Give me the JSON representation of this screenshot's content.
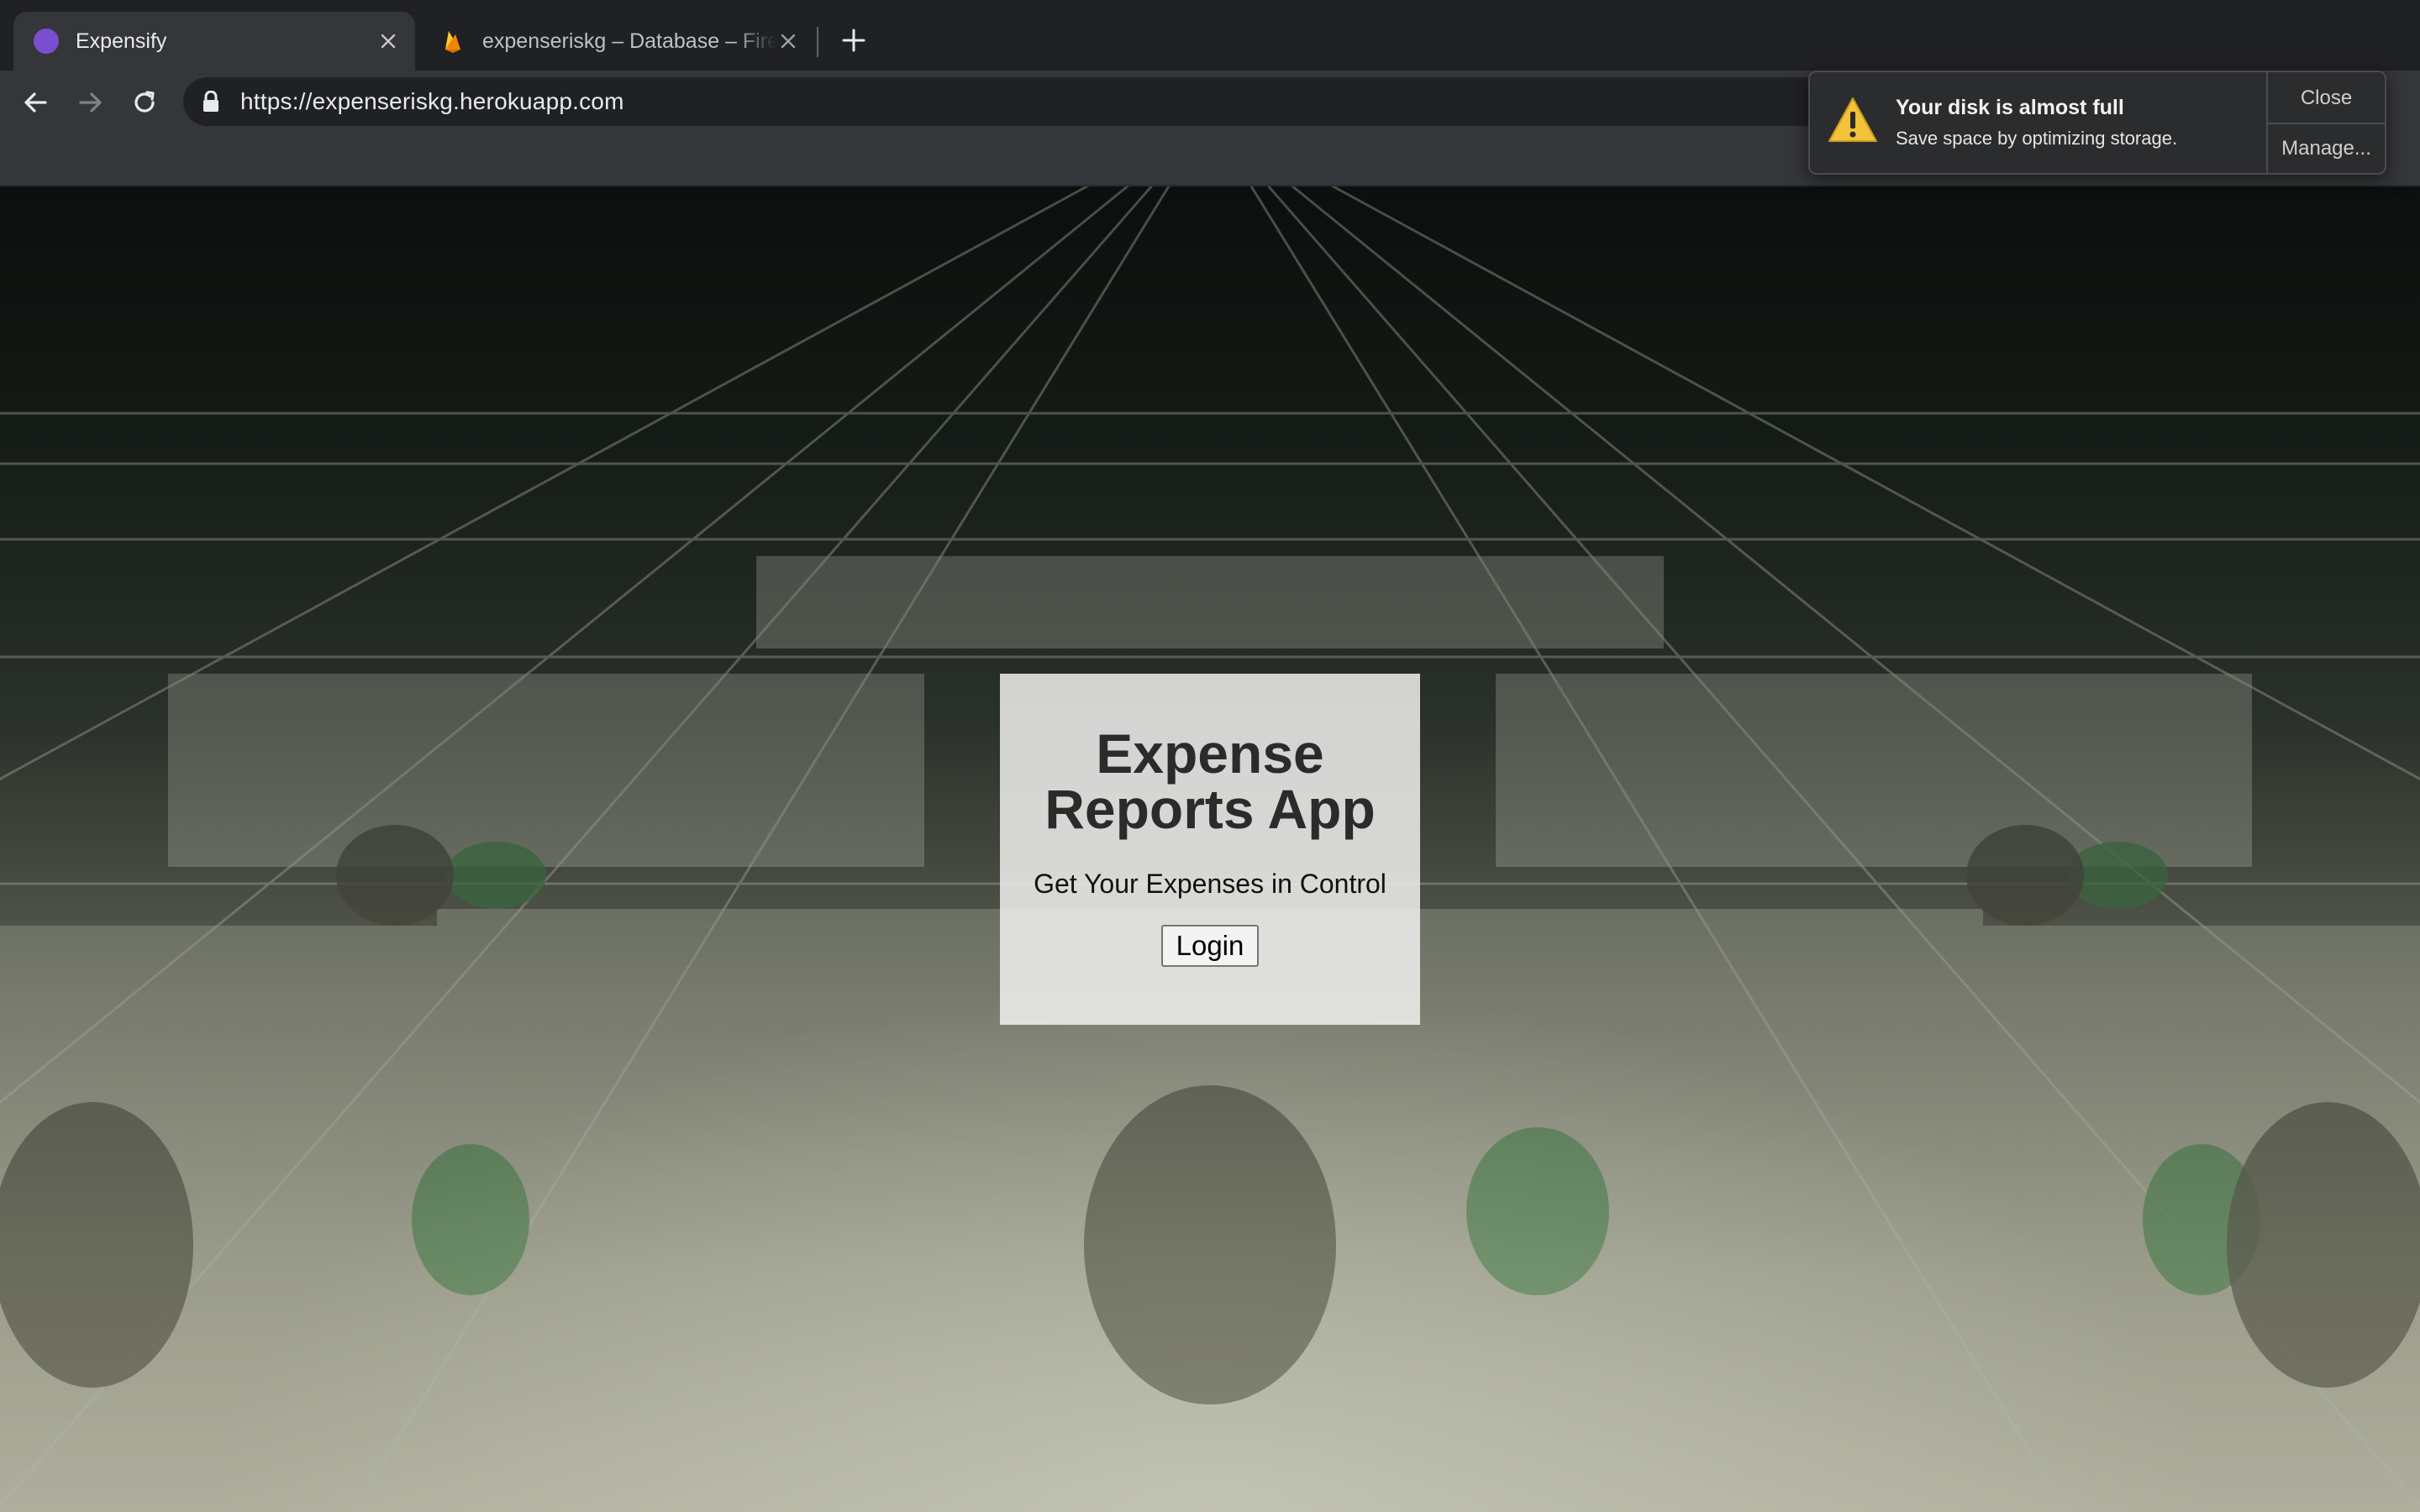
{
  "browser": {
    "tabs": [
      {
        "title": "Expensify",
        "favicon": "purple-circle-icon",
        "active": true
      },
      {
        "title": "expenseriskg – Database – Firebase console",
        "favicon": "firebase-flame-icon",
        "active": false
      }
    ],
    "address_bar": {
      "url": "https://expenseriskg.herokuapp.com"
    }
  },
  "notification": {
    "title": "Your disk is almost full",
    "body": "Save space by optimizing storage.",
    "close_label": "Close",
    "manage_label": "Manage...",
    "icon": "warning-triangle-icon"
  },
  "page": {
    "background": "dollar-bills-image",
    "title": "Expense Reports App",
    "subtitle": "Get Your Expenses in Control",
    "login_label": "Login"
  },
  "colors": {
    "tab_active": "#35363a",
    "tabstrip": "#202124",
    "favicon_purple": "#7a4fcf",
    "firebase_yellow": "#f5a623",
    "warning_yellow": "#f2c23a"
  }
}
